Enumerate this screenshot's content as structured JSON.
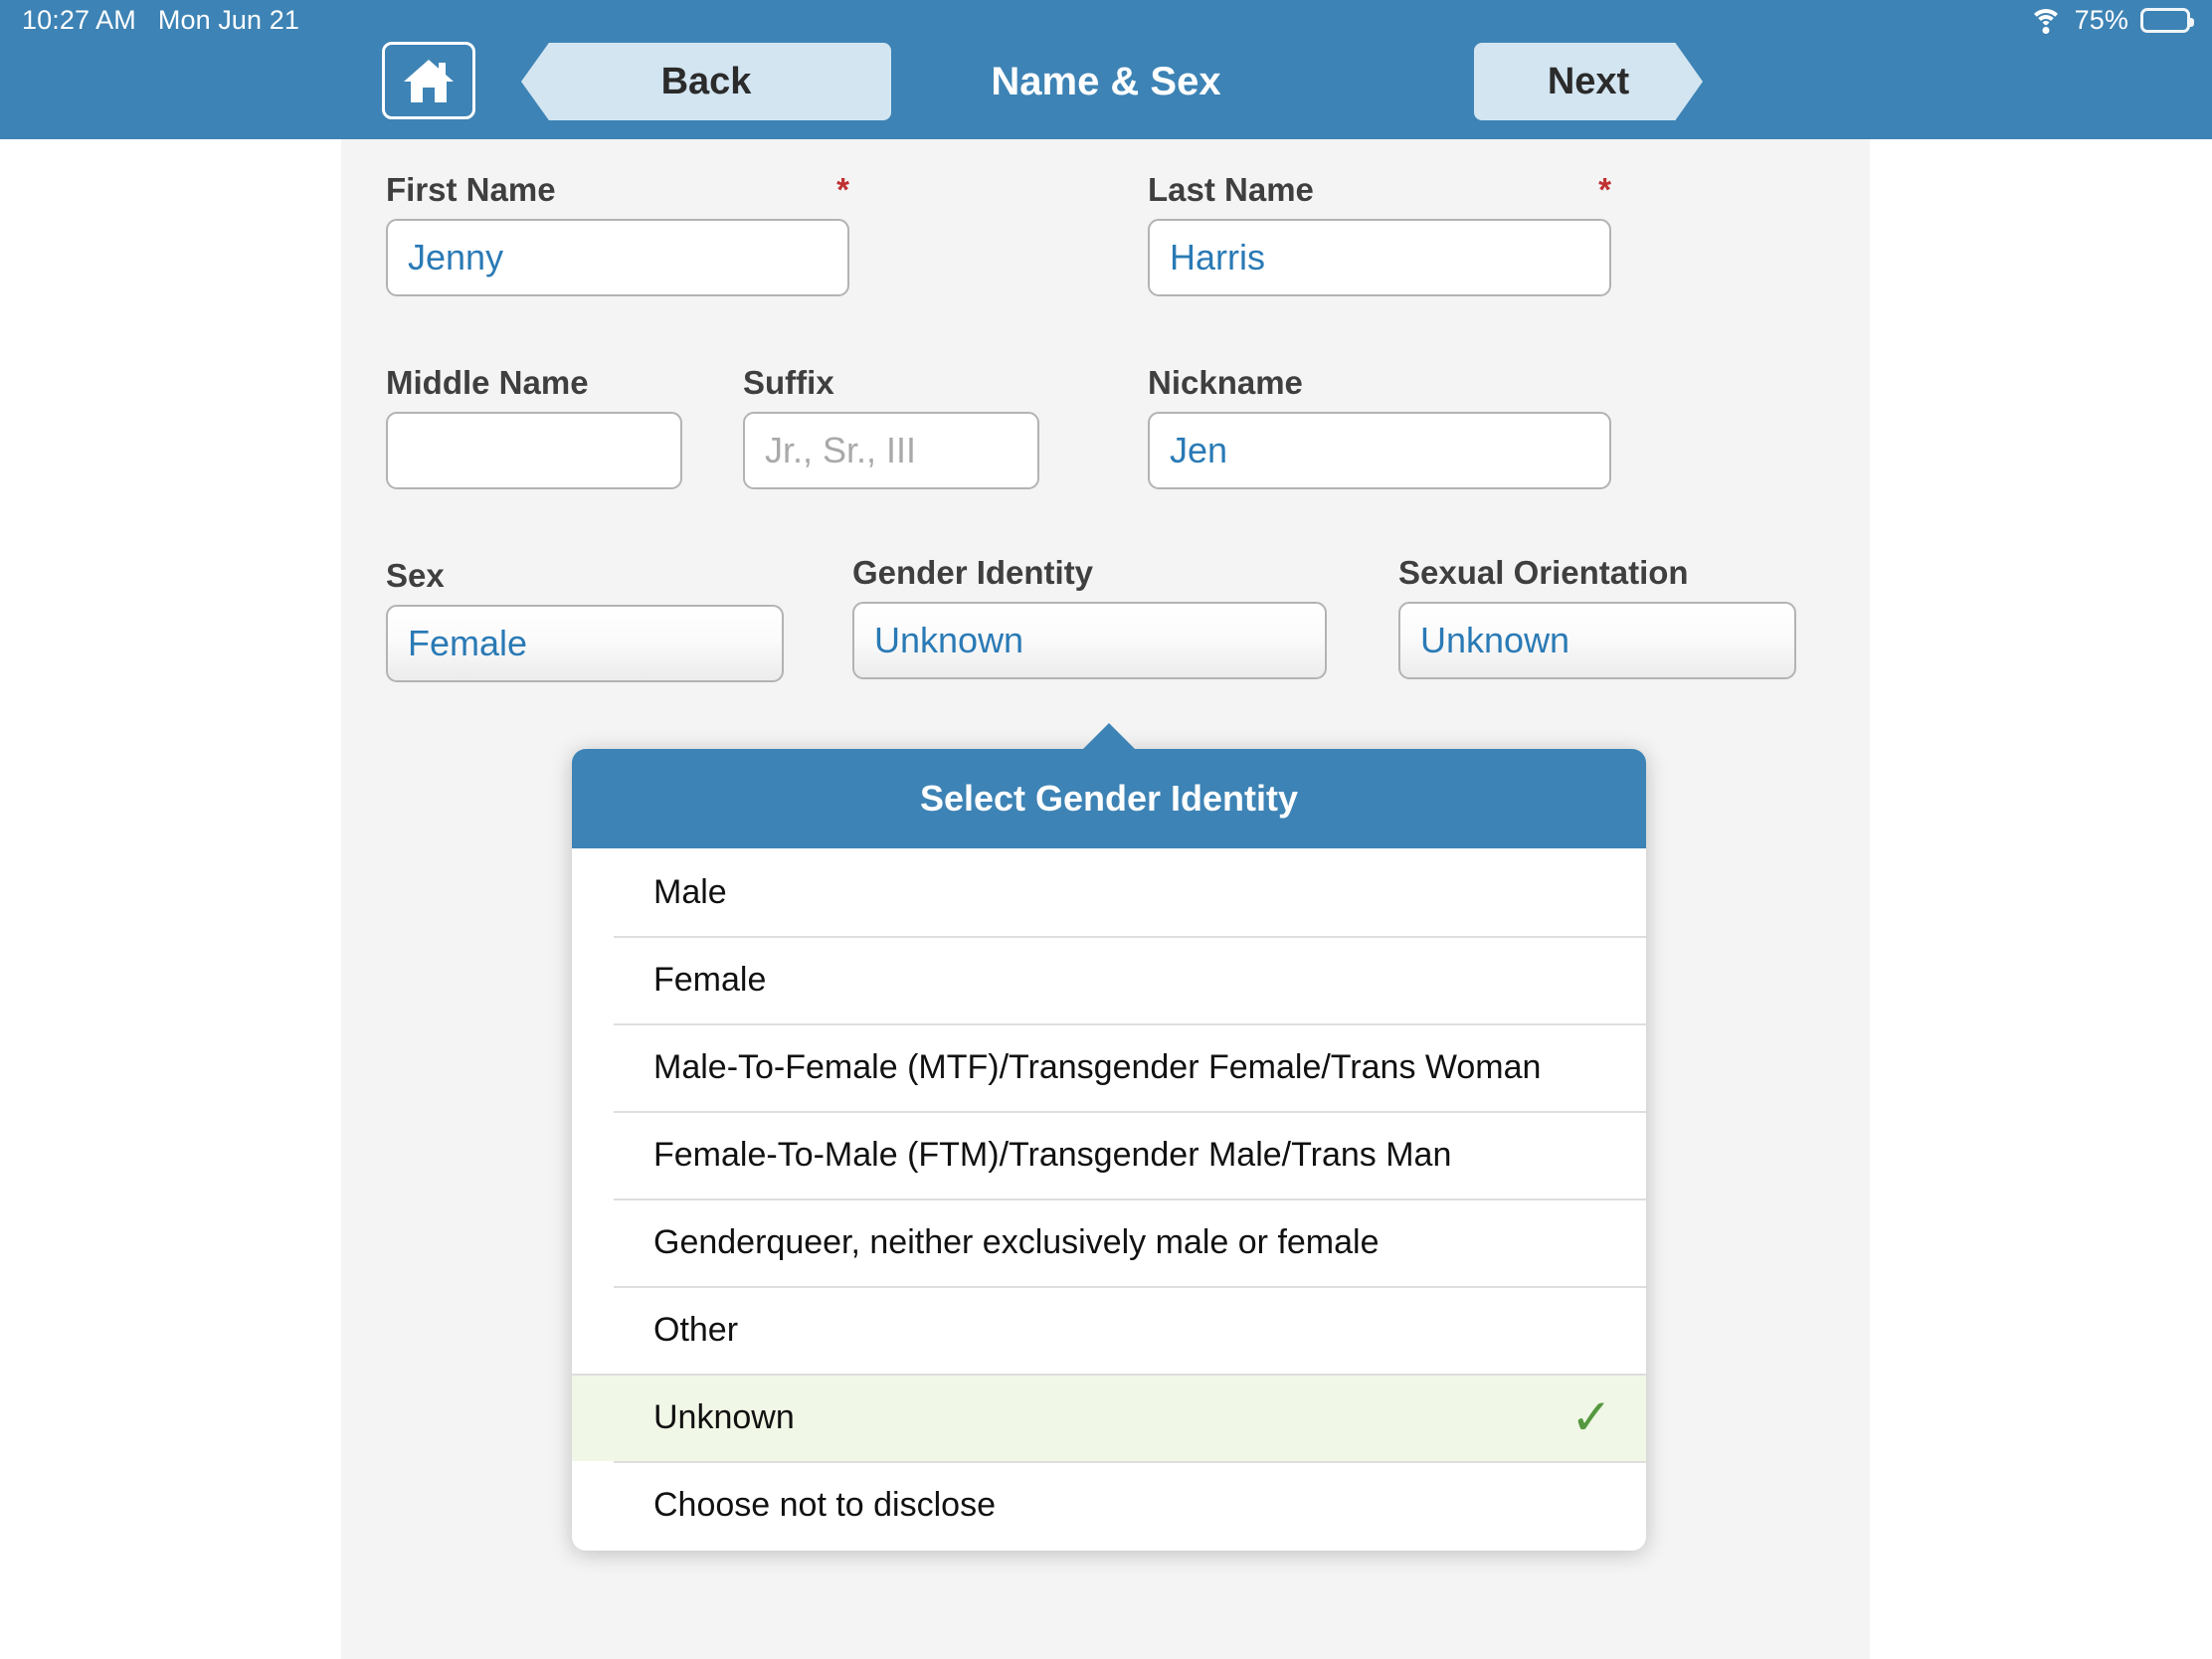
{
  "status_bar": {
    "time": "10:27 AM",
    "date": "Mon Jun 21",
    "wifi_icon": "wifi-icon",
    "battery_percent": "75%",
    "battery_level": 75
  },
  "nav_bar": {
    "home_icon": "home-icon",
    "back_label": "Back",
    "title": "Name & Sex",
    "next_label": "Next",
    "bar_color": "#3d83b5",
    "button_color": "#d3e5f1"
  },
  "form": {
    "required_marker": "*",
    "fields": [
      {
        "label": "First Name",
        "value": "Jenny",
        "placeholder": "",
        "required": true,
        "type": "text"
      },
      {
        "label": "Last Name",
        "value": "Harris",
        "placeholder": "",
        "required": true,
        "type": "text"
      },
      {
        "label": "Middle Name",
        "value": "",
        "placeholder": "",
        "required": false,
        "type": "text"
      },
      {
        "label": "Suffix",
        "value": "",
        "placeholder": "Jr., Sr., III",
        "required": false,
        "type": "text"
      },
      {
        "label": "Nickname",
        "value": "Jen",
        "placeholder": "",
        "required": false,
        "type": "text"
      },
      {
        "label": "Sex",
        "value": "Female",
        "placeholder": "",
        "required": false,
        "type": "select"
      },
      {
        "label": "Gender Identity",
        "value": "Unknown",
        "placeholder": "",
        "required": false,
        "type": "select"
      },
      {
        "label": "Sexual Orientation",
        "value": "Unknown",
        "placeholder": "",
        "required": false,
        "type": "select"
      }
    ]
  },
  "popover": {
    "title": "Select Gender Identity",
    "check_icon": "check-icon",
    "check_color": "#56983f",
    "selected_row_color": "#f0f7e6",
    "options": [
      {
        "label": "Male",
        "selected": false
      },
      {
        "label": "Female",
        "selected": false
      },
      {
        "label": "Male-To-Female (MTF)/Transgender Female/Trans Woman",
        "selected": false
      },
      {
        "label": "Female-To-Male (FTM)/Transgender Male/Trans Man",
        "selected": false
      },
      {
        "label": "Genderqueer, neither exclusively male or female",
        "selected": false
      },
      {
        "label": "Other",
        "selected": false
      },
      {
        "label": "Unknown",
        "selected": true
      },
      {
        "label": "Choose not to disclose",
        "selected": false
      }
    ]
  }
}
